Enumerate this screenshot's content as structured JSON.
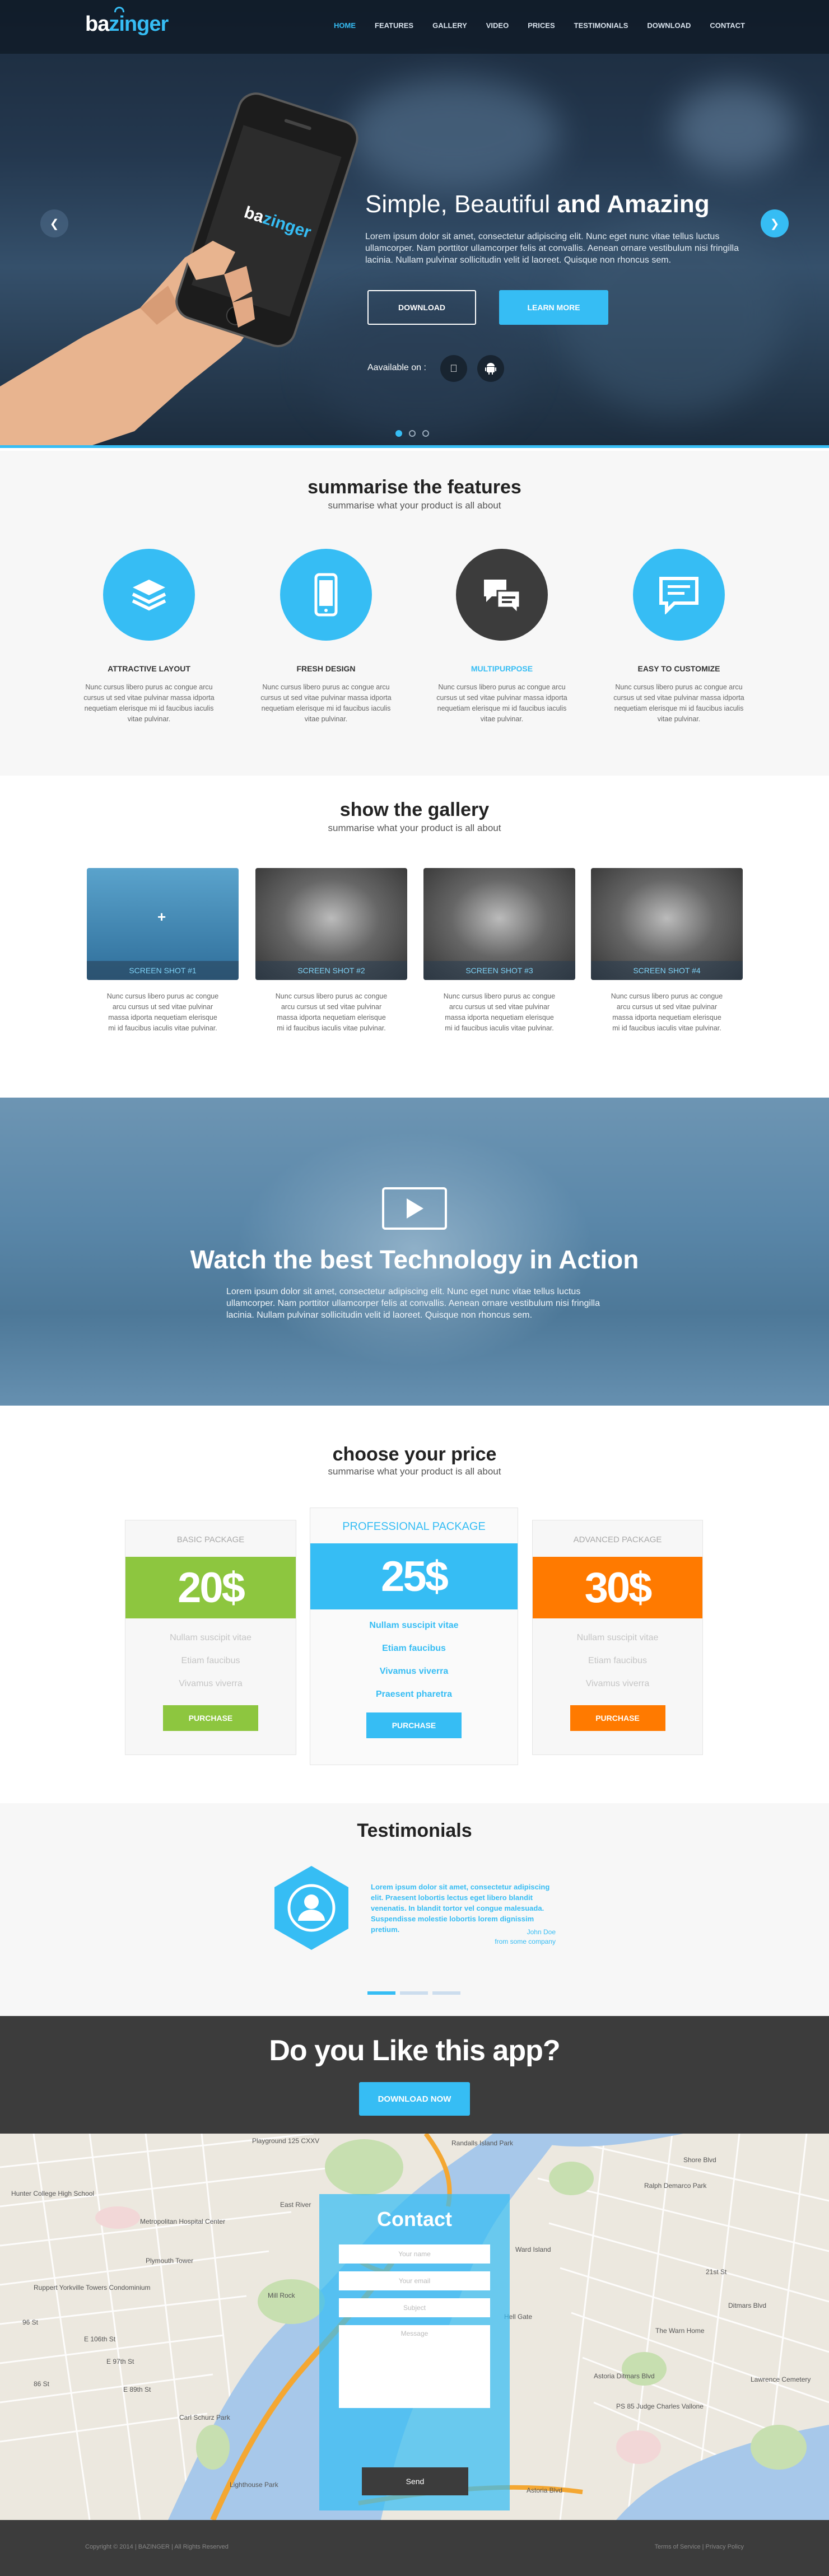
{
  "brand": {
    "logo_pre": "ba",
    "logo_post": "zinger",
    "accent": "#36bdf4"
  },
  "nav": {
    "items": [
      "HOME",
      "FEATURES",
      "GALLERY",
      "VIDEO",
      "PRICES",
      "TESTIMONIALS",
      "DOWNLOAD",
      "CONTACT"
    ],
    "active": "HOME"
  },
  "hero": {
    "title_plain": "Simple, Beautiful ",
    "title_bold": "and Amazing",
    "text": "Lorem ipsum dolor sit amet, consectetur adipiscing elit. Nunc eget nunc vitae tellus luctus ullamcorper. Nam porttitor ullamcorper felis at convallis. Aenean ornare vestibulum nisi fringilla lacinia. Nullam pulvinar sollicitudin velit id laoreet. Quisque non rhoncus sem.",
    "download_label": "DOWNLOAD",
    "learn_label": "LEARN MORE",
    "available": "Aavailable on :",
    "phone_logo": "bazinger"
  },
  "features": {
    "title": "summarise the features",
    "subtitle": "summarise what your product is all about",
    "items": [
      {
        "name": "ATTRACTIVE LAYOUT",
        "text": "Nunc cursus libero purus ac congue arcu cursus ut sed vitae pulvinar massa idporta nequetiam elerisque mi id faucibus iaculis vitae pulvinar.",
        "color": "#36bdf4",
        "icon": "layers-icon"
      },
      {
        "name": "FRESH DESIGN",
        "text": "Nunc cursus libero purus ac congue arcu cursus ut sed vitae pulvinar massa idporta nequetiam elerisque mi id faucibus iaculis vitae pulvinar.",
        "color": "#36bdf4",
        "icon": "phone-icon"
      },
      {
        "name": "MULTIPURPOSE",
        "text": "Nunc cursus libero purus ac congue arcu cursus ut sed vitae pulvinar massa idporta nequetiam elerisque mi id faucibus iaculis vitae pulvinar.",
        "color": "#3c3c3c",
        "icon": "chat-icon"
      },
      {
        "name": "EASY TO CUSTOMIZE",
        "text": "Nunc cursus libero purus ac congue arcu cursus ut sed vitae pulvinar massa idporta nequetiam elerisque mi id faucibus iaculis vitae pulvinar.",
        "color": "#36bdf4",
        "icon": "message-icon"
      }
    ]
  },
  "gallery": {
    "title": "show the gallery",
    "subtitle": "summarise what your product is all about",
    "items": [
      {
        "caption": "SCREEN SHOT #1",
        "text": "Nunc cursus libero purus ac congue arcu cursus ut sed vitae pulvinar massa idporta nequetiam elerisque mi id faucibus iaculis vitae pulvinar."
      },
      {
        "caption": "SCREEN SHOT #2",
        "text": "Nunc cursus libero purus ac congue arcu cursus ut sed vitae pulvinar massa idporta nequetiam elerisque mi id faucibus iaculis vitae pulvinar."
      },
      {
        "caption": "SCREEN SHOT #3",
        "text": "Nunc cursus libero purus ac congue arcu cursus ut sed vitae pulvinar massa idporta nequetiam elerisque mi id faucibus iaculis vitae pulvinar."
      },
      {
        "caption": "SCREEN SHOT #4",
        "text": "Nunc cursus libero purus ac congue arcu cursus ut sed vitae pulvinar massa idporta nequetiam elerisque mi id faucibus iaculis vitae pulvinar."
      }
    ]
  },
  "video": {
    "title_plain": "Watch the best Technology in ",
    "title_bold": "Action",
    "text": "Lorem ipsum dolor sit amet, consectetur adipiscing elit. Nunc eget nunc vitae tellus luctus ullamcorper. Nam porttitor ullamcorper felis at convallis. Aenean ornare vestibulum nisi fringilla lacinia. Nullam pulvinar sollicitudin velit id laoreet. Quisque non rhoncus sem."
  },
  "pricing": {
    "title": "choose your price",
    "subtitle": "summarise what your product is all about",
    "plans": [
      {
        "name": "BASIC PACKAGE",
        "price": "20$",
        "color": "#8dc63f",
        "features": [
          "Nullam suscipit vitae",
          "Etiam faucibus",
          "Vivamus viverra"
        ],
        "button": "PURCHASE"
      },
      {
        "name": "PROFESSIONAL PACKAGE",
        "price": "25$",
        "color": "#36bdf4",
        "features": [
          "Nullam suscipit vitae",
          "Etiam faucibus",
          "Vivamus viverra",
          "Praesent pharetra"
        ],
        "button": "PURCHASE"
      },
      {
        "name": "ADVANCED PACKAGE",
        "price": "30$",
        "color": "#ff7a00",
        "features": [
          "Nullam suscipit vitae",
          "Etiam faucibus",
          "Vivamus viverra"
        ],
        "button": "PURCHASE"
      }
    ]
  },
  "testimonials": {
    "title": "Testimonials",
    "quote": "Lorem ipsum dolor sit amet, consectetur adipiscing elit. Praesent lobortis lectus eget libero blandit venenatis. In blandit tortor vel congue malesuada. Suspendisse molestie lobortis lorem dignissim pretium.",
    "author": "John Doe",
    "author_org": "from some company"
  },
  "cta": {
    "title": "Do you Like this app?",
    "button": "DOWNLOAD NOW"
  },
  "contact": {
    "title": "Contact",
    "name_ph": "Your name",
    "email_ph": "Your email",
    "subject_ph": "Subject",
    "message_ph": "Message",
    "send": "Send"
  },
  "map_labels": [
    "Hunter College High School",
    "Metropolitan Hospital Center",
    "Plymouth Tower",
    "Ruppert Yorkville Towers Condominium",
    "Carl Schurz Park",
    "Lighthouse Park",
    "Mill Rock",
    "Randalls Island Park",
    "Ward Island",
    "Playground 125 CXXV",
    "Ralph Demarco Park",
    "The Warn Home",
    "Astoria Ditmars Blvd",
    "PS 85 Judge Charles Vallone",
    "Lawrence Cemetery",
    "Astoria Blvd",
    "96 St",
    "86 St",
    "E 106th St",
    "E 97th St",
    "E 89th St",
    "Hell Gate",
    "East River",
    "Shore Blvd",
    "21st St",
    "Ditmars Blvd"
  ],
  "footer": {
    "copyright": "Copyright © 2014 | BAZINGER | All Rights Reserved",
    "links": "Terms of Service | Privacy Policy"
  }
}
